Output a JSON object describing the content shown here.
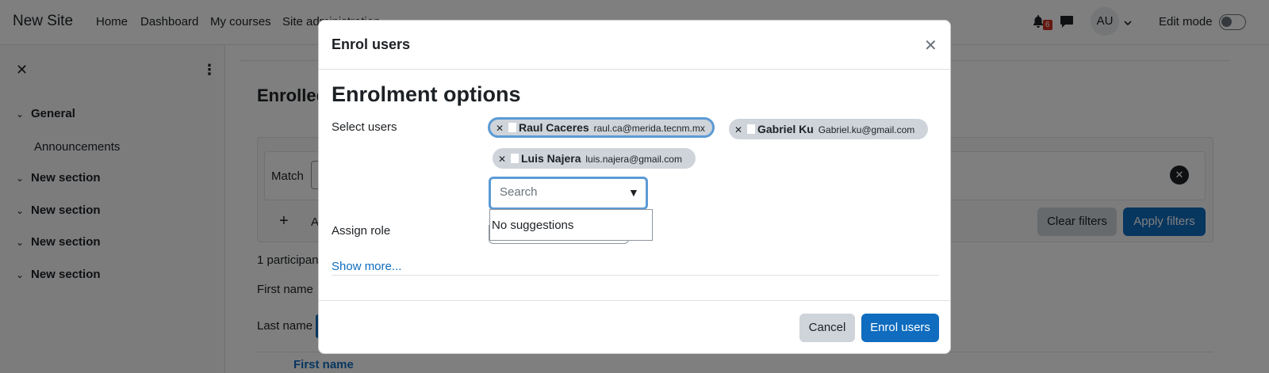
{
  "navbar": {
    "site_name": "New Site",
    "links": [
      "Home",
      "Dashboard",
      "My courses",
      "Site administration"
    ],
    "notification_count": "6",
    "user_initials": "AU",
    "edit_mode_label": "Edit mode"
  },
  "course_index": {
    "items": [
      {
        "label": "General"
      },
      {
        "label": "Announcements"
      },
      {
        "label": "New section"
      },
      {
        "label": "New section"
      },
      {
        "label": "New section"
      },
      {
        "label": "New section"
      }
    ]
  },
  "main": {
    "title_partial": "Enrolled",
    "match_label": "Match",
    "add_condition_partial": "A",
    "clear_filters": "Clear filters",
    "apply_filters": "Apply filters",
    "participants_partial": "1 participan",
    "first_name_filter": "First name",
    "last_name_filter": "Last name",
    "table_first_name": "First name"
  },
  "modal": {
    "title": "Enrol users",
    "section_title": "Enrolment options",
    "select_users_label": "Select users",
    "selected_users": [
      {
        "name": "Raul Caceres",
        "email": "raul.ca@merida.tecnm.mx"
      },
      {
        "name": "Gabriel Ku",
        "email": "Gabriel.ku@gmail.com"
      },
      {
        "name": "Luis Najera",
        "email": "luis.najera@gmail.com"
      }
    ],
    "search_placeholder": "Search",
    "no_suggestions": "No suggestions",
    "assign_role_label": "Assign role",
    "show_more": "Show more...",
    "cancel": "Cancel",
    "enrol_users": "Enrol users"
  }
}
